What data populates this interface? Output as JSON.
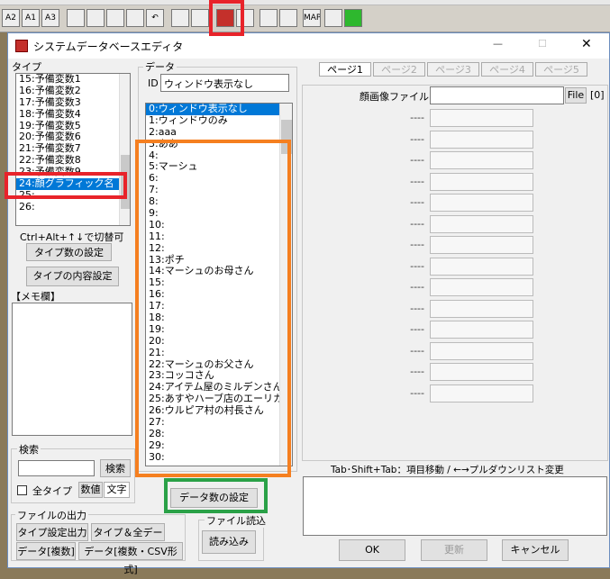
{
  "window": {
    "title": "システムデータベースエディタ",
    "min": "—",
    "max": "☐",
    "close": "✕"
  },
  "type_panel": {
    "label": "タイプ",
    "items": [
      "15:予備変数1",
      "16:予備変数2",
      "17:予備変数3",
      "18:予備変数4",
      "19:予備変数5",
      "20:予備変数6",
      "21:予備変数7",
      "22:予備変数8",
      "23:予備変数9",
      "24:顔グラフィック名",
      "25:",
      "26:"
    ],
    "hint": "Ctrl+Alt+↑↓で切替可",
    "btn_type_count": "タイプ数の設定",
    "btn_type_content": "タイプの内容設定",
    "memo_label": "【メモ欄】",
    "search_label": "検索",
    "btn_search": "検索",
    "all_types": "全タイプ",
    "btn_number": "数値",
    "btn_text": "文字",
    "file_output_label": "ファイルの出力",
    "btn_type_out": "タイプ設定出力",
    "btn_type_all": "タイプ＆全データ",
    "btn_data_multi": "データ[複数]",
    "btn_data_csv": "データ[複数・CSV形式]"
  },
  "data_panel": {
    "label": "データ",
    "id_label": "ID",
    "id_value": "ウィンドウ表示なし",
    "items": [
      "0:ウィンドウ表示なし",
      "1:ウィンドウのみ",
      "2:aaa",
      "3:ああ",
      "4:",
      "5:マーシュ",
      "6:",
      "7:",
      "8:",
      "9:",
      "10:",
      "11:",
      "12:",
      "13:ポチ",
      "14:マーシュのお母さん",
      "15:",
      "16:",
      "17:",
      "18:",
      "19:",
      "20:",
      "21:",
      "22:マーシュのお父さん",
      "23:コッコさん",
      "24:アイテム屋のミルデンさん",
      "25:あすやハーブ店のエーリカ",
      "26:ウルピア村の村長さん",
      "27:",
      "28:",
      "29:",
      "30:"
    ],
    "btn_data_count": "データ数の設定",
    "file_read_label": "ファイル読込",
    "btn_read": "読み込み"
  },
  "right_panel": {
    "tabs": [
      "ページ1",
      "ページ2",
      "ページ3",
      "ページ4",
      "ページ5"
    ],
    "face_label": "顔画像ファイル",
    "btn_file": "File",
    "bracket": "[0]",
    "dash": "----",
    "hint": "Tab･Shift+Tab：項目移動 / ←→プルダウンリスト変更",
    "btn_ok": "OK",
    "btn_update": "更新",
    "btn_cancel": "キャンセル"
  },
  "toolbar_icons": [
    "map-a-icon",
    "map-b-icon",
    "map-c-icon",
    "pencil-icon",
    "brush-icon",
    "select-icon",
    "event-icon",
    "undo-icon",
    "db-user-icon",
    "db-variable-icon",
    "db-system-icon",
    "book-icon",
    "wrench-icon",
    "character-icon",
    "map-icon",
    "list-icon",
    "play-icon"
  ],
  "toolbar_labels": [
    "A2",
    "A1",
    "A3",
    "",
    "",
    "",
    "",
    "↶",
    "",
    "",
    "",
    "",
    "",
    "",
    "MAP",
    "",
    ""
  ],
  "colors": {
    "highlight_red": "#e8232a",
    "highlight_orange": "#f57f20",
    "highlight_green": "#2aa147",
    "selection": "#0078d7"
  }
}
